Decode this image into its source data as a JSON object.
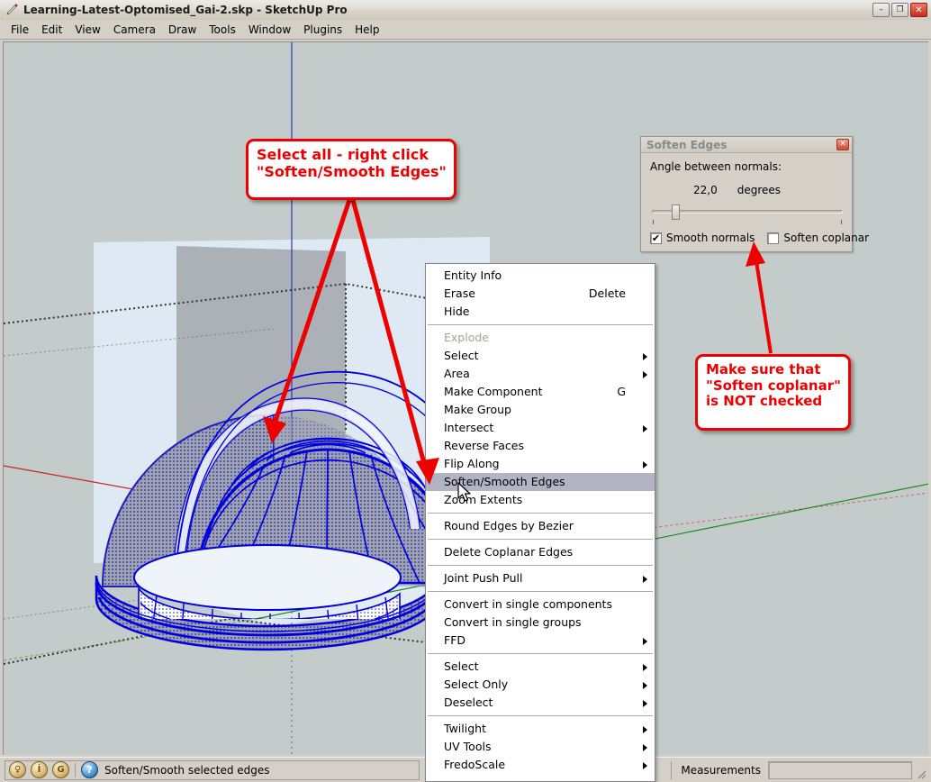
{
  "window": {
    "title": "Learning-Latest-Optomised_Gai-2.skp - SketchUp Pro",
    "app_icon": "sketchup-pencil-icon",
    "minimize_label": "–",
    "maximize_label": "❐",
    "close_label": "✕"
  },
  "menubar": {
    "items": [
      {
        "label": "File"
      },
      {
        "label": "Edit"
      },
      {
        "label": "View"
      },
      {
        "label": "Camera"
      },
      {
        "label": "Draw"
      },
      {
        "label": "Tools"
      },
      {
        "label": "Window"
      },
      {
        "label": "Plugins"
      },
      {
        "label": "Help"
      }
    ]
  },
  "viewport": {
    "background_color": "#c3ccca",
    "sky_color": "#c3ccca",
    "red_axis_color": "#cc2222",
    "green_axis_color": "#1a8a1a",
    "blue_axis_color": "#3333aa",
    "selection_color": "#0000dd",
    "face_fill_color": "#dfe9f3",
    "model_description": "Selected dome / parabolic shell geometry with blue selection highlight"
  },
  "context_menu": {
    "groups": [
      {
        "items": [
          {
            "label": "Entity Info",
            "accel": "",
            "arrow": false,
            "disabled": false,
            "selected": false
          },
          {
            "label": "Erase",
            "accel": "Delete",
            "arrow": false,
            "disabled": false,
            "selected": false
          },
          {
            "label": "Hide",
            "accel": "",
            "arrow": false,
            "disabled": false,
            "selected": false
          }
        ]
      },
      {
        "items": [
          {
            "label": "Explode",
            "accel": "",
            "arrow": false,
            "disabled": true,
            "selected": false
          },
          {
            "label": "Select",
            "accel": "",
            "arrow": true,
            "disabled": false,
            "selected": false
          },
          {
            "label": "Area",
            "accel": "",
            "arrow": true,
            "disabled": false,
            "selected": false
          },
          {
            "label": "Make Component",
            "accel": "G",
            "arrow": false,
            "disabled": false,
            "selected": false
          },
          {
            "label": "Make Group",
            "accel": "",
            "arrow": false,
            "disabled": false,
            "selected": false
          },
          {
            "label": "Intersect",
            "accel": "",
            "arrow": true,
            "disabled": false,
            "selected": false
          },
          {
            "label": "Reverse Faces",
            "accel": "",
            "arrow": false,
            "disabled": false,
            "selected": false
          },
          {
            "label": "Flip Along",
            "accel": "",
            "arrow": true,
            "disabled": false,
            "selected": false
          },
          {
            "label": "Soften/Smooth Edges",
            "accel": "",
            "arrow": false,
            "disabled": false,
            "selected": true
          },
          {
            "label": "Zoom Extents",
            "accel": "",
            "arrow": false,
            "disabled": false,
            "selected": false
          }
        ]
      },
      {
        "items": [
          {
            "label": "Round Edges by Bezier",
            "accel": "",
            "arrow": false,
            "disabled": false,
            "selected": false
          }
        ]
      },
      {
        "items": [
          {
            "label": "Delete Coplanar Edges",
            "accel": "",
            "arrow": false,
            "disabled": false,
            "selected": false
          }
        ]
      },
      {
        "items": [
          {
            "label": "Joint Push Pull",
            "accel": "",
            "arrow": true,
            "disabled": false,
            "selected": false
          }
        ]
      },
      {
        "items": [
          {
            "label": "Convert in single components",
            "accel": "",
            "arrow": false,
            "disabled": false,
            "selected": false
          },
          {
            "label": "Convert in single groups",
            "accel": "",
            "arrow": false,
            "disabled": false,
            "selected": false
          },
          {
            "label": "FFD",
            "accel": "",
            "arrow": true,
            "disabled": false,
            "selected": false
          }
        ]
      },
      {
        "items": [
          {
            "label": "Select",
            "accel": "",
            "arrow": true,
            "disabled": false,
            "selected": false
          },
          {
            "label": "Select Only",
            "accel": "",
            "arrow": true,
            "disabled": false,
            "selected": false
          },
          {
            "label": "Deselect",
            "accel": "",
            "arrow": true,
            "disabled": false,
            "selected": false
          }
        ]
      },
      {
        "items": [
          {
            "label": "Twilight",
            "accel": "",
            "arrow": true,
            "disabled": false,
            "selected": false
          },
          {
            "label": "UV Tools",
            "accel": "",
            "arrow": true,
            "disabled": false,
            "selected": false
          },
          {
            "label": "FredoScale",
            "accel": "",
            "arrow": true,
            "disabled": false,
            "selected": false
          }
        ]
      }
    ]
  },
  "soften_dialog": {
    "title": "Soften Edges",
    "close_label": "✕",
    "angle_label": "Angle between normals:",
    "angle_value": "22,0",
    "angle_unit": "degrees",
    "slider_percent": 11,
    "smooth_normals": {
      "label": "Smooth normals",
      "checked": true,
      "mark": "✔"
    },
    "soften_coplanar": {
      "label": "Soften coplanar",
      "checked": false,
      "mark": ""
    }
  },
  "callouts": [
    {
      "id": "callout-select-all",
      "lines": [
        "Select all - right click",
        "\"Soften/Smooth Edges\""
      ],
      "color": "#ee0000"
    },
    {
      "id": "callout-soften-coplanar",
      "lines": [
        "Make sure that",
        "\"Soften coplanar\"",
        "is NOT checked"
      ],
      "color": "#ee0000"
    }
  ],
  "statusbar": {
    "geo_icons": [
      {
        "name": "location-pin-icon",
        "glyph": "♀"
      },
      {
        "name": "person-icon",
        "glyph": "İ"
      },
      {
        "name": "google-g-icon",
        "glyph": "G"
      }
    ],
    "help_icon_glyph": "?",
    "status_text": "Soften/Smooth selected edges",
    "measurements_label": "Measurements",
    "measurements_value": ""
  }
}
